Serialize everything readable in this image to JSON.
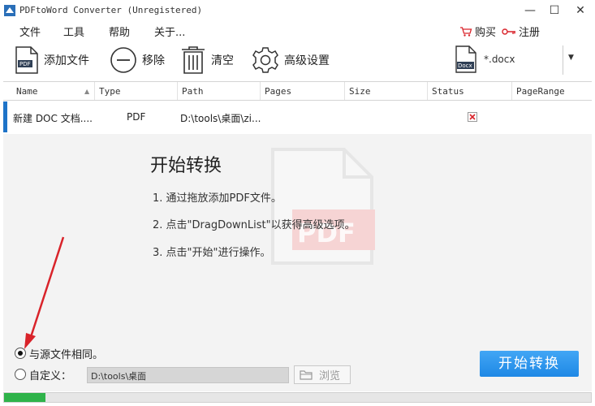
{
  "window": {
    "title": "PDFtoWord Converter (Unregistered)",
    "minimize": "—",
    "maximize": "☐",
    "close": "✕"
  },
  "menu": {
    "file": "文件",
    "tools": "工具",
    "help": "帮助",
    "about": "关于...",
    "buy": "购买",
    "register": "注册"
  },
  "toolbar": {
    "add_file": "添加文件",
    "remove": "移除",
    "clear": "清空",
    "advanced": "高级设置",
    "format_icon_label": "Docx",
    "format": "*.docx"
  },
  "table": {
    "columns": [
      "Name",
      "Type",
      "Path",
      "Pages",
      "Size",
      "Status",
      "PageRange"
    ],
    "rows": [
      {
        "name": "新建 DOC 文档....",
        "type": "PDF",
        "path": "D:\\tools\\桌面\\zi...",
        "pages": "",
        "size": "",
        "status": "error",
        "page_range": ""
      }
    ]
  },
  "guide": {
    "title": "开始转换",
    "steps": [
      "1. 通过拖放添加PDF文件。",
      "2. 点击\"DragDownList\"以获得高级选项。",
      "3. 点击\"开始\"进行操作。"
    ],
    "watermark_text": "PDF"
  },
  "output": {
    "same_as_source": "与源文件相同。",
    "custom": "自定义：",
    "custom_path": "D:\\tools\\桌面",
    "browse": "浏览",
    "selected": "same_as_source"
  },
  "start_button": "开始转换",
  "progress": 0.07,
  "colors": {
    "accent": "#1e88e5",
    "progress": "#2fb34a",
    "annotation_arrow": "#d9232a"
  }
}
